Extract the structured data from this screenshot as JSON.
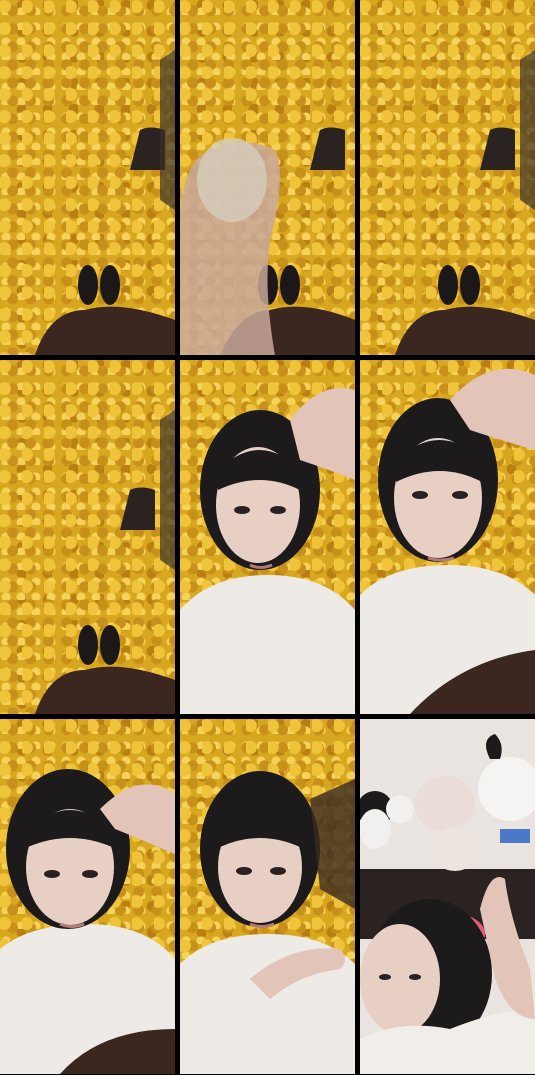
{
  "frames": [
    {
      "scene": "ginkgo-leaves-feet"
    },
    {
      "scene": "ginkgo-leaves-finger"
    },
    {
      "scene": "ginkgo-leaves-feet"
    },
    {
      "scene": "ginkgo-leaves-feet"
    },
    {
      "scene": "selfie-ginkgo"
    },
    {
      "scene": "selfie-ginkgo"
    },
    {
      "scene": "selfie-ginkgo"
    },
    {
      "scene": "selfie-ginkgo"
    },
    {
      "scene": "selfie-room-plush"
    }
  ],
  "colors": {
    "leaves": "#d8a720",
    "skin": "#e8cfc4",
    "hair": "#1d1a1c",
    "shirt": "#eeeae6",
    "blanket": "#3b2620",
    "gap": "#000000"
  }
}
